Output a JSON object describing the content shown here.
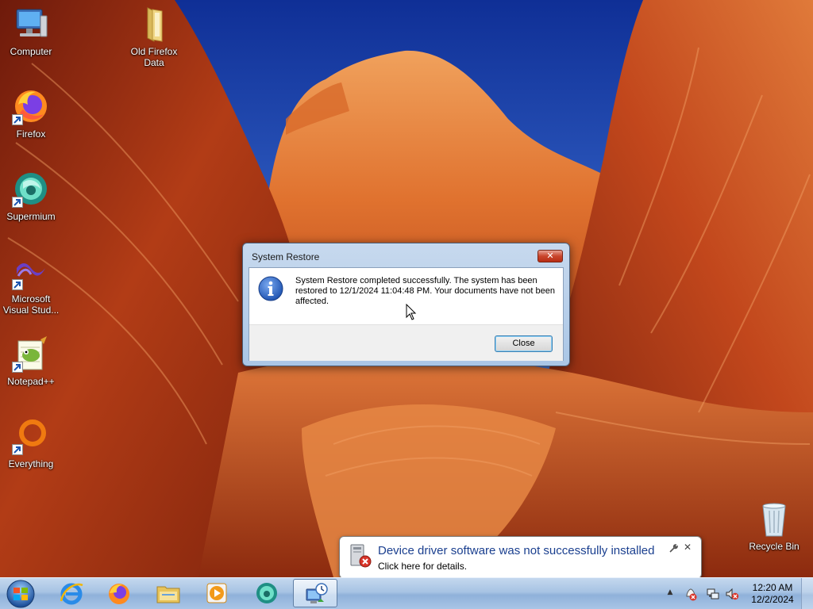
{
  "desktop": {
    "icons": [
      {
        "label": "Computer"
      },
      {
        "label": "Old Firefox Data"
      },
      {
        "label": "Firefox"
      },
      {
        "label": "Supermium"
      },
      {
        "label": "Microsoft Visual Stud..."
      },
      {
        "label": "Notepad++"
      },
      {
        "label": "Everything"
      },
      {
        "label": "Recycle Bin"
      }
    ]
  },
  "dialog": {
    "title": "System Restore",
    "close_glyph": "✕",
    "message": "System Restore completed successfully. The system has been restored to 12/1/2024 11:04:48 PM. Your documents have not been affected.",
    "close_button": "Close",
    "icon": "info-icon"
  },
  "notification": {
    "title": "Device driver software was not successfully installed",
    "text": "Click here for details.",
    "close_glyph": "✕",
    "icon": "device-error-icon"
  },
  "taskbar": {
    "pinned": [
      {
        "icon": "internet-explorer-icon"
      },
      {
        "icon": "firefox-icon"
      },
      {
        "icon": "file-explorer-icon"
      },
      {
        "icon": "media-player-icon"
      },
      {
        "icon": "supermium-icon"
      },
      {
        "icon": "system-restore-icon",
        "active": true
      }
    ],
    "tray": {
      "show_hidden_glyph": "▲",
      "time": "12:20 AM",
      "date": "12/2/2024"
    }
  },
  "colors": {
    "dialog_frame": "#aac6e6",
    "taskbar": "#a7c3e3",
    "notification_title": "#1a3f8f"
  }
}
